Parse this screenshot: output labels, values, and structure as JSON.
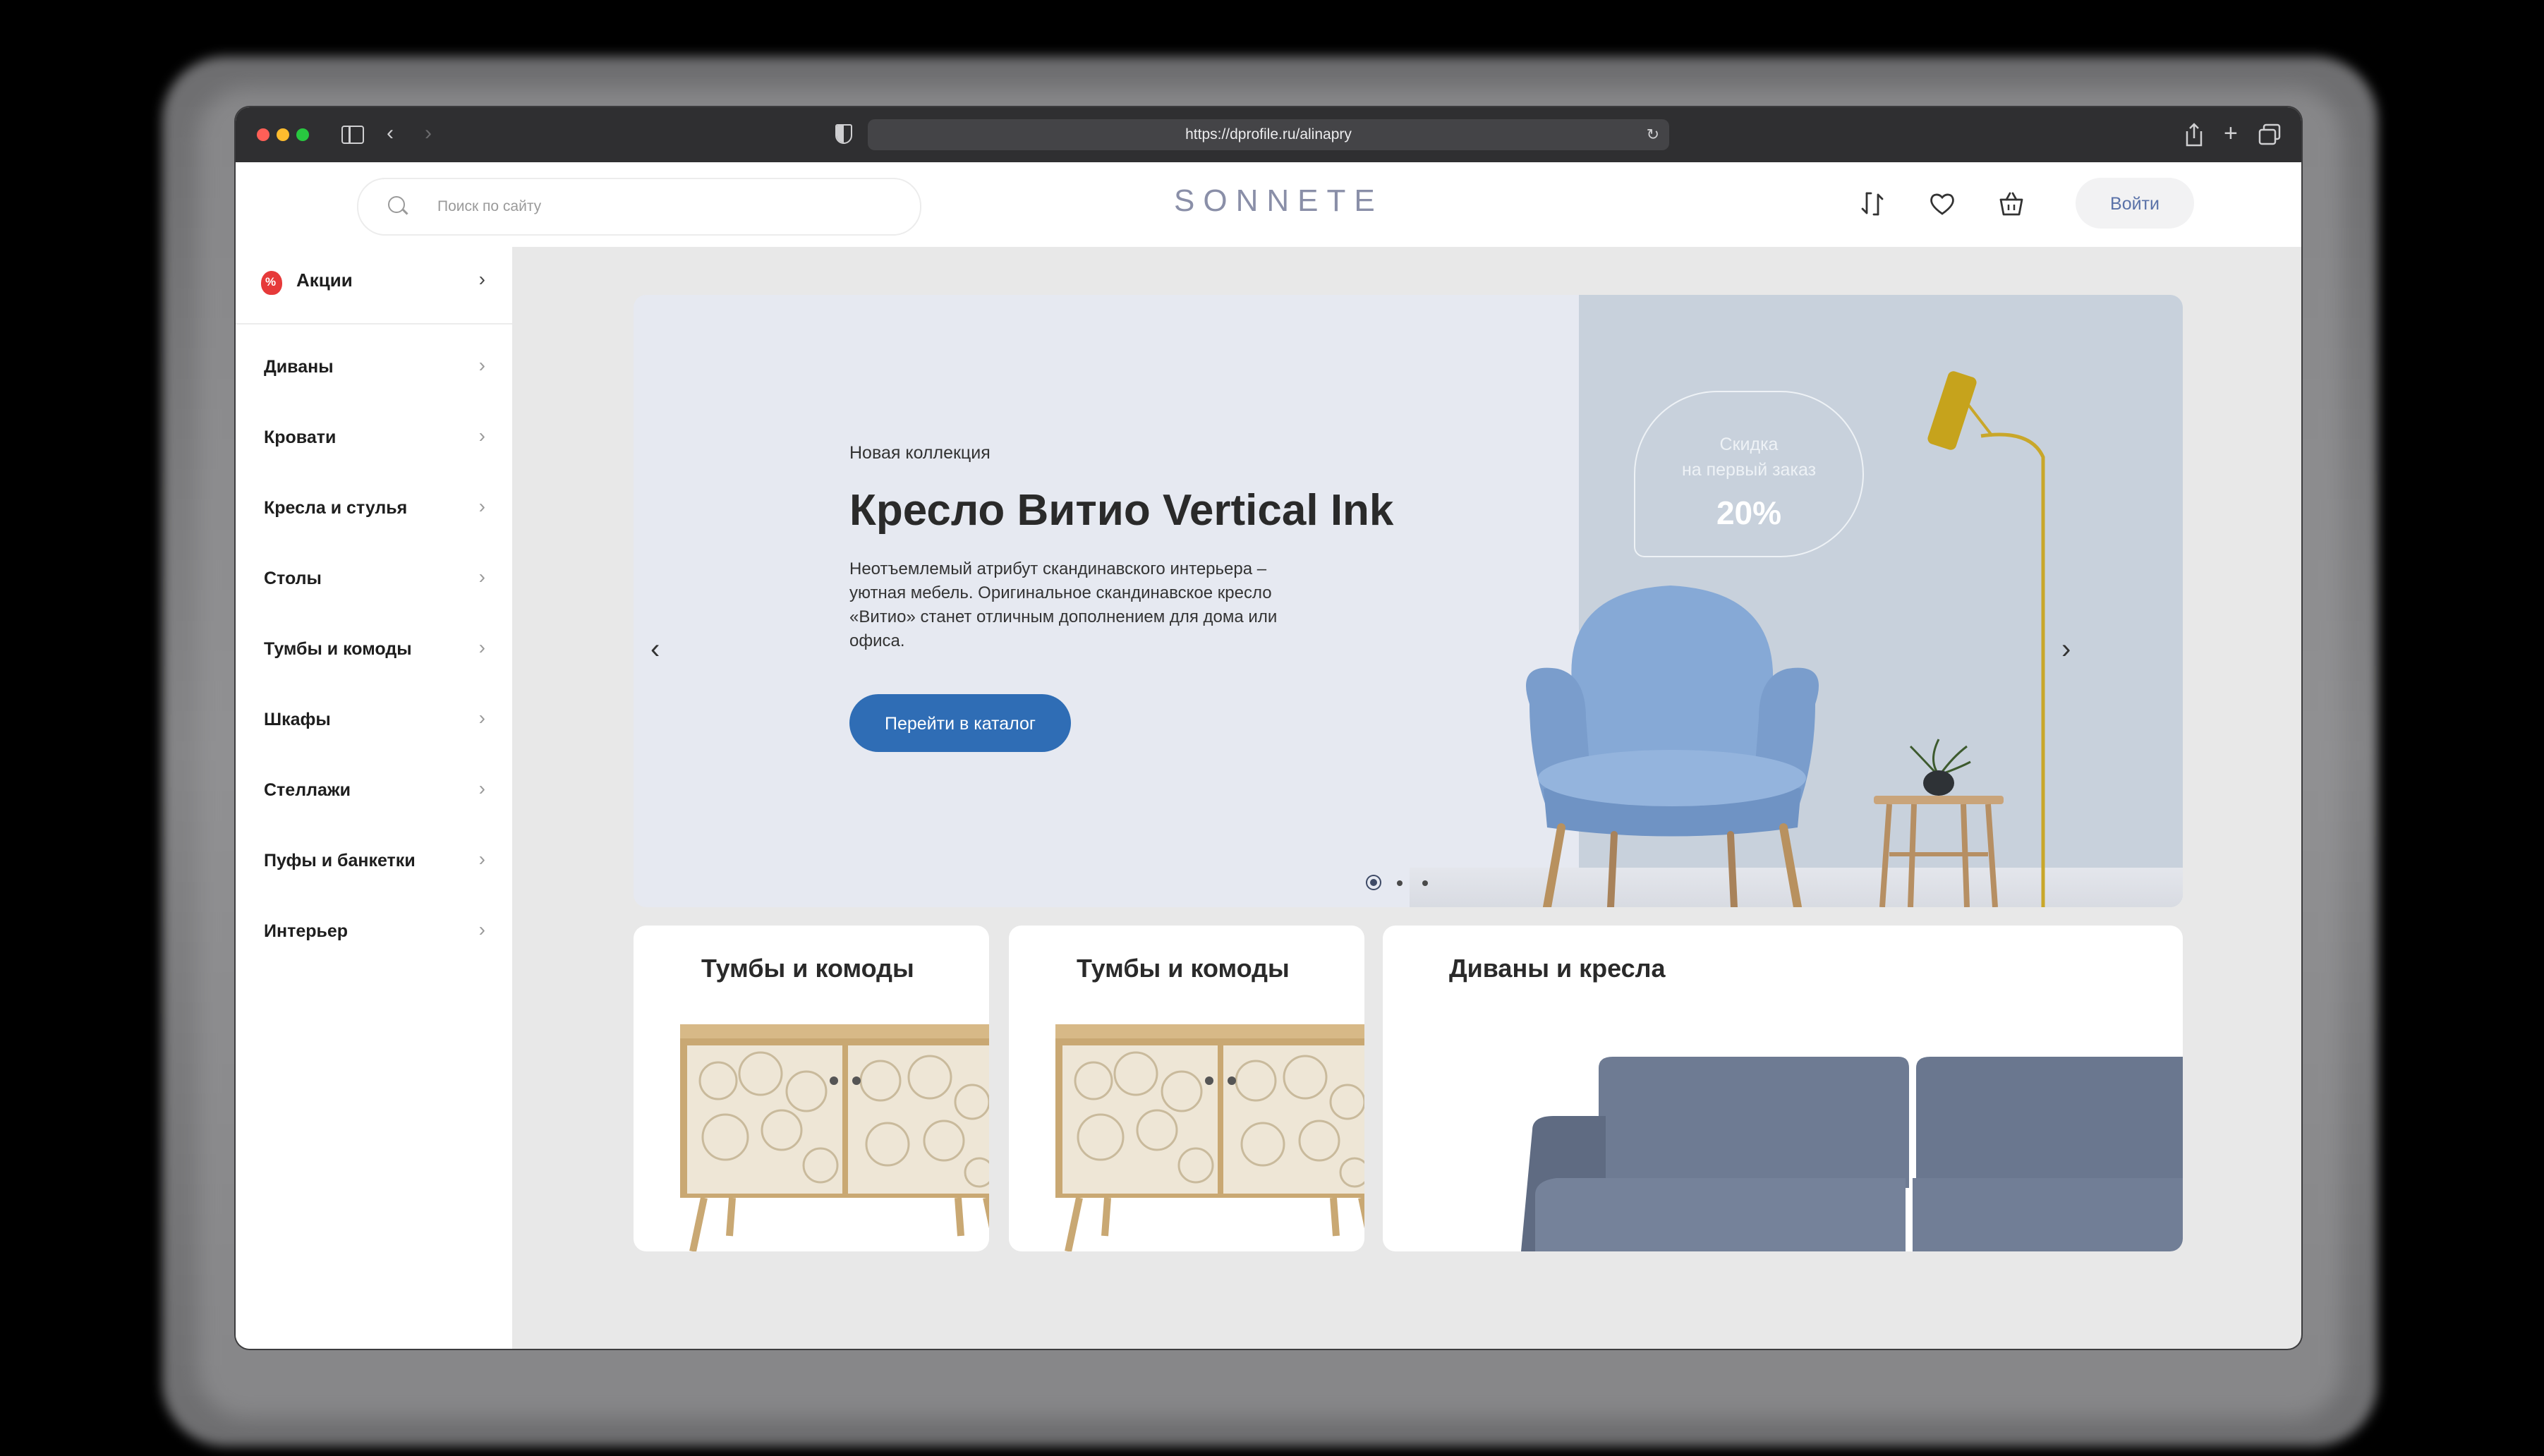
{
  "browser": {
    "url": "https://dprofile.ru/alinapry"
  },
  "header": {
    "search_placeholder": "Поиск по сайту",
    "logo": "SONNETE",
    "login_label": "Войти"
  },
  "sidebar": {
    "promo_label": "Акции",
    "items": [
      {
        "label": "Диваны"
      },
      {
        "label": "Кровати"
      },
      {
        "label": "Кресла и стулья"
      },
      {
        "label": "Столы"
      },
      {
        "label": "Тумбы и комоды"
      },
      {
        "label": "Шкафы"
      },
      {
        "label": "Стеллажи"
      },
      {
        "label": "Пуфы и банкетки"
      },
      {
        "label": "Интерьер"
      }
    ]
  },
  "hero": {
    "subtitle": "Новая коллекция",
    "title": "Кресло Витио Vertical Ink",
    "description": "Неотъемлемый атрибут скандинавского интерьера – уютная мебель. Оригинальное скандинавское кресло «Витио» станет отличным дополнением для дома или офиса.",
    "cta_label": "Перейти в каталог",
    "badge": {
      "line1": "Скидка",
      "line2": "на первый заказ",
      "value": "20%"
    },
    "slides_total": 3,
    "active_slide": 1
  },
  "cards": [
    {
      "title": "Тумбы и комоды"
    },
    {
      "title": "Тумбы и комоды"
    },
    {
      "title": "Диваны и кресла"
    }
  ],
  "colors": {
    "accent": "#2f6db5",
    "logo": "#8a8fa8",
    "chair": "#86a9d6",
    "sofa": "#6e7b93"
  }
}
